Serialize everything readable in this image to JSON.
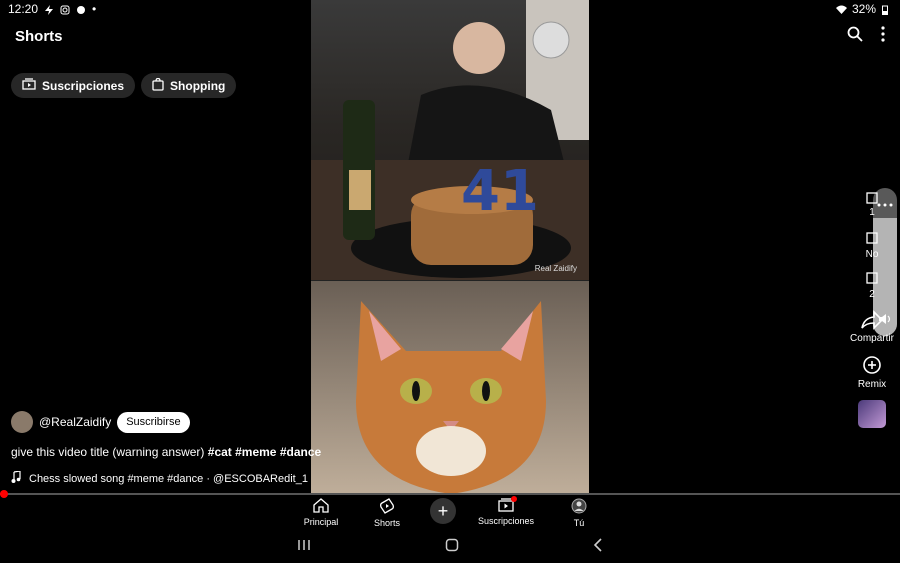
{
  "status": {
    "time": "12:20",
    "battery": "32%"
  },
  "header": {
    "title": "Shorts"
  },
  "chips": [
    {
      "label": "Suscripciones",
      "icon": "subscriptions-icon"
    },
    {
      "label": "Shopping",
      "icon": "shopping-bag-icon"
    }
  ],
  "video": {
    "watermark": "Real Zaidify",
    "channel": "@RealZaidify",
    "subscribe_label": "Suscribirse",
    "title_text": "give this video title (warning answer) ",
    "title_tags": "#cat #meme #dance",
    "music": "Chess slowed song #meme #dance · @ESCOBARedit_1"
  },
  "rail": {
    "like_count": "1",
    "dislike_label": "No",
    "comments_count": "2",
    "share_label": "Compartir",
    "remix_label": "Remix"
  },
  "volume_level": 0.8,
  "nav": [
    {
      "label": "Principal",
      "icon": "home-icon"
    },
    {
      "label": "Shorts",
      "icon": "shorts-icon"
    },
    {
      "label": "Suscripciones",
      "icon": "subscriptions-icon"
    },
    {
      "label": "Tú",
      "icon": "profile-icon"
    }
  ],
  "colors": {
    "accent": "#ff0000",
    "chip_bg": "#272727"
  }
}
